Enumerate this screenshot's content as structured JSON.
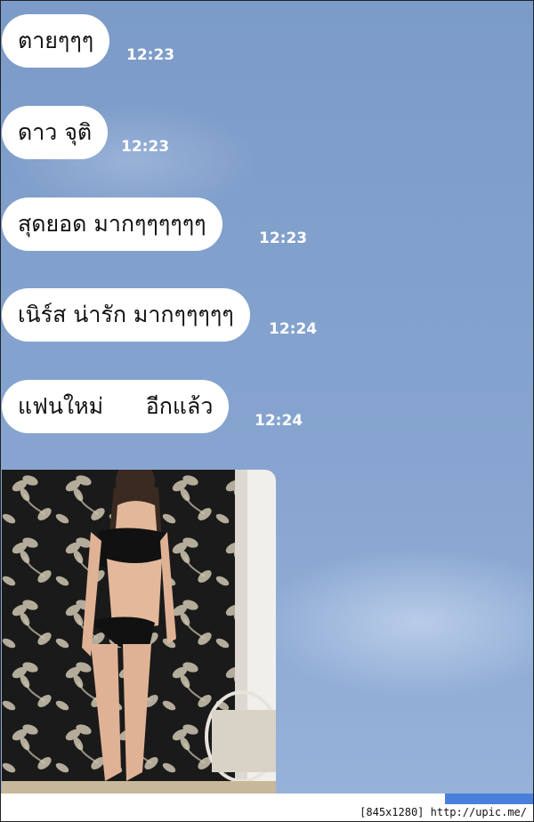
{
  "messages": [
    {
      "text": "ตายๆๆๆ",
      "time": "12:23"
    },
    {
      "text": "ดาว จุติ",
      "time": "12:23"
    },
    {
      "text": "สุดยอด มากๆๆๆๆๆๆ",
      "time": "12:23"
    },
    {
      "text": "เนิร์ส น่ารัก มากๆๆๆๆๆ",
      "time": "12:24"
    },
    {
      "text": "แฟนใหม่      อีกแล้ว",
      "time": "12:24"
    }
  ],
  "image_message": {
    "icon": "photo-icon"
  },
  "watermark": "[845x1280] http://upic.me/",
  "colors": {
    "background": "#7f9fcc",
    "bubble": "#ffffff",
    "time": "#ffffff",
    "accent": "#4a7fdc"
  }
}
